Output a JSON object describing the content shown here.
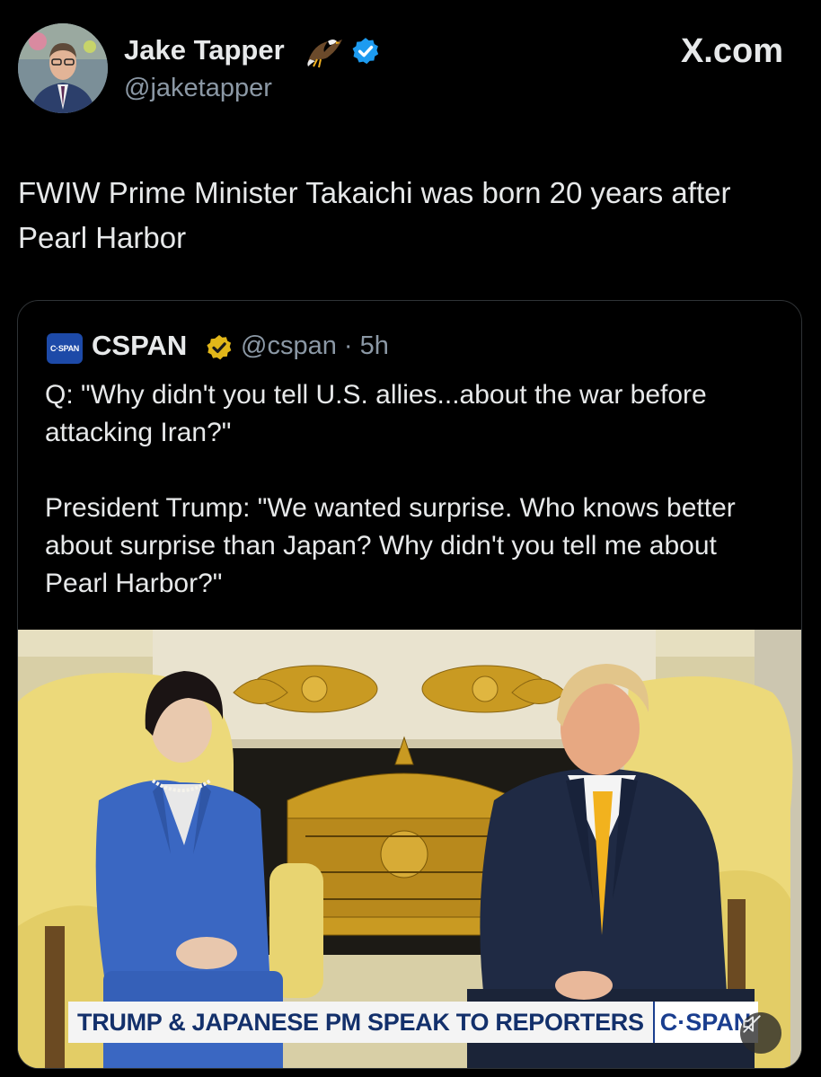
{
  "tweet": {
    "author_name": "Jake Tapper",
    "author_handle": "@jaketapper",
    "brand": "X.com",
    "text": "FWIW Prime Minister Takaichi was born 20 years after Pearl Harbor"
  },
  "quoted": {
    "logo_text": "C·SPAN",
    "name": "CSPAN",
    "handle_time": "@cspan · 5h",
    "paragraph_1": "Q: \"Why didn't you tell U.S. allies...about the war before attacking Iran?\"",
    "paragraph_2": "President Trump: \"We wanted surprise. Who knows better about surprise than Japan? Why didn't you tell me about Pearl Harbor?\"",
    "media": {
      "lower_third": "TRUMP & JAPANESE PM SPEAK TO REPORTERS",
      "network_logo": "C·SPAN",
      "mute_icon": "speaker-muted-icon"
    }
  },
  "colors": {
    "background": "#000000",
    "text_primary": "#e7e9ea",
    "text_secondary": "#8b98a5",
    "verified_blue": "#1d9bf0",
    "verified_gold": "#e2b719",
    "card_border": "#2f3336"
  }
}
